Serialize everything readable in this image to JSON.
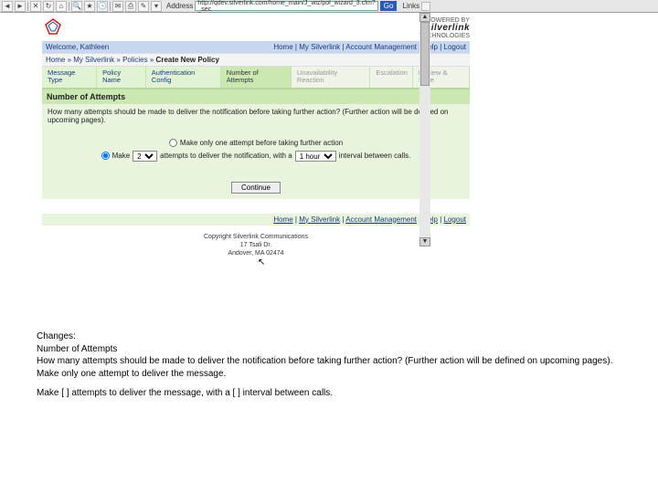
{
  "toolbar": {
    "icons": [
      "back",
      "fwd",
      "stop",
      "refresh",
      "home",
      "search",
      "fav",
      "hist",
      "mail",
      "print",
      "edit",
      "tools"
    ],
    "address_label": "Address",
    "address_value": "http://qdev.silverlink.com/home_main/J_wiz/pol_wizard_3.cfm?_sec",
    "go_label": "Go",
    "links_label": "Links"
  },
  "brand": {
    "powered_by": "POWERED BY",
    "name": "silverlink",
    "sub": "TECHNOLOGIES"
  },
  "welcome": {
    "text": "Welcome, Kathleen",
    "links": [
      "Home",
      "My Silverlink",
      "Account Management",
      "Help",
      "Logout"
    ]
  },
  "breadcrumb": {
    "parts": [
      "Home",
      "My Silverlink",
      "Policies"
    ],
    "current": "Create New Policy"
  },
  "tabs": [
    {
      "label": "Message\nType",
      "state": "link"
    },
    {
      "label": "Policy\nName",
      "state": "link"
    },
    {
      "label": "Authentication\nConfig",
      "state": "link"
    },
    {
      "label": "Number of\nAttempts",
      "state": "active"
    },
    {
      "label": "Unavailability\nReaction",
      "state": "dim"
    },
    {
      "label": "Escalation",
      "state": "dim"
    },
    {
      "label": "Review & Save",
      "state": "dim"
    }
  ],
  "section": {
    "title": "Number of Attempts",
    "prompt": "How many attempts should be made to deliver the notification before taking further action? (Further action will be defined on upcoming pages).",
    "opt1": "Make only one attempt before taking further action",
    "opt2_pre": "Make",
    "opt2_mid": "attempts to deliver the notification, with a",
    "opt2_post": "interval between calls.",
    "sel_attempts": "2",
    "sel_interval": "1 hour",
    "continue": "Continue"
  },
  "footer": {
    "links": [
      "Home",
      "My Silverlink",
      "Account Management",
      "Help",
      "Logout"
    ],
    "copyright1": "Copyright Silverlink Communications",
    "copyright2": "17 Tsali Dr.",
    "copyright3": "Andover, MA 02474"
  },
  "changes": {
    "h": "Changes:",
    "t": "Number of Attempts",
    "p1": "How many attempts should be made to deliver the notification before taking further action? (Further action will be defined on upcoming pages).",
    "p2": "Make only one attempt to deliver the message.",
    "p3": "Make [  ] attempts to deliver the message, with a [  ] interval between calls."
  }
}
